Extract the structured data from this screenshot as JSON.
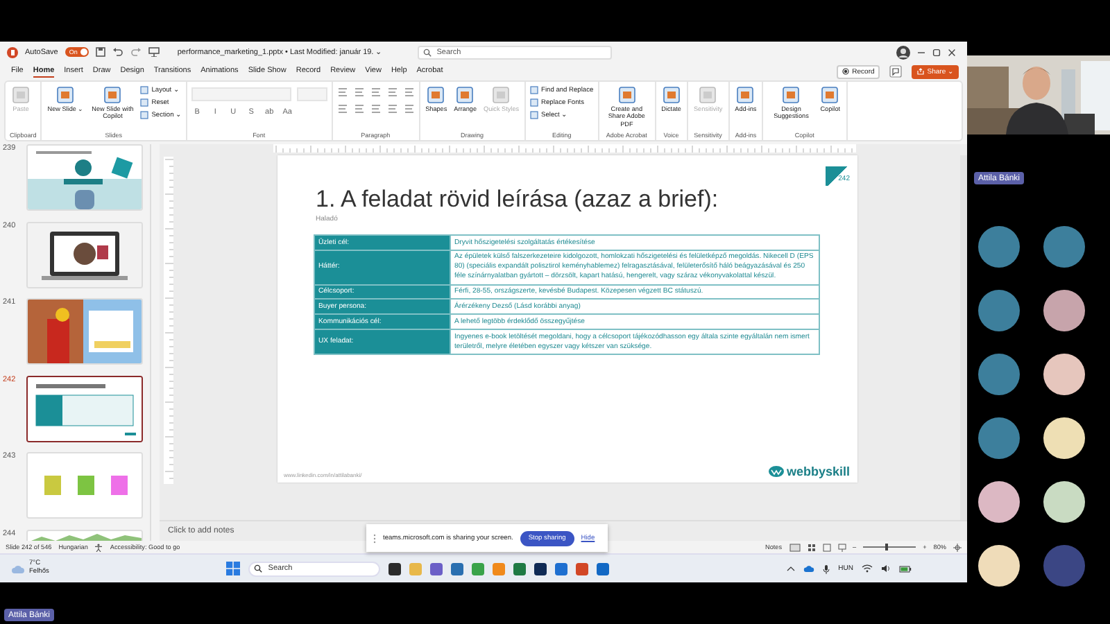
{
  "title_bar": {
    "autosave_label": "AutoSave",
    "autosave": {
      "on": true,
      "label": "On"
    },
    "file_title": "performance_marketing_1.pptx • Last Modified: január 19. ⌄",
    "search_placeholder": "Search"
  },
  "menu_tabs": [
    {
      "label": "File",
      "selected": false
    },
    {
      "label": "Home",
      "selected": true
    },
    {
      "label": "Insert",
      "selected": false
    },
    {
      "label": "Draw",
      "selected": false
    },
    {
      "label": "Design",
      "selected": false
    },
    {
      "label": "Transitions",
      "selected": false
    },
    {
      "label": "Animations",
      "selected": false
    },
    {
      "label": "Slide Show",
      "selected": false
    },
    {
      "label": "Record",
      "selected": false
    },
    {
      "label": "Review",
      "selected": false
    },
    {
      "label": "View",
      "selected": false
    },
    {
      "label": "Help",
      "selected": false
    },
    {
      "label": "Acrobat",
      "selected": false
    }
  ],
  "record_button": "Record",
  "share_button": "Share ⌄",
  "ribbon_groups": [
    {
      "kind": "buttons",
      "label": "Clipboard",
      "items": [
        {
          "label": "Paste",
          "kind": "large",
          "disabled": true
        }
      ]
    },
    {
      "kind": "buttons",
      "label": "Slides",
      "items": [
        {
          "label": "New Slide ⌄",
          "kind": "large",
          "disabled": false
        },
        {
          "label": "New Slide with Copilot",
          "kind": "large",
          "disabled": false
        },
        {
          "label": "Layout ⌄",
          "kind": "small",
          "disabled": false
        },
        {
          "label": "Reset",
          "kind": "small",
          "disabled": false
        },
        {
          "label": "Section ⌄",
          "kind": "small",
          "disabled": false
        }
      ]
    },
    {
      "kind": "font",
      "label": "Font",
      "items": [
        {
          "label": "B"
        },
        {
          "label": "I"
        },
        {
          "label": "U"
        },
        {
          "label": "S"
        },
        {
          "label": "ab"
        },
        {
          "label": "Aa"
        }
      ]
    },
    {
      "kind": "paragraph",
      "label": "Paragraph"
    },
    {
      "kind": "buttons",
      "label": "Drawing",
      "items": [
        {
          "label": "Shapes",
          "kind": "large",
          "disabled": false
        },
        {
          "label": "Arrange",
          "kind": "large",
          "disabled": false
        },
        {
          "label": "Quick Styles",
          "kind": "large",
          "disabled": true
        }
      ]
    },
    {
      "kind": "buttons",
      "label": "Editing",
      "items": [
        {
          "label": "Find and Replace",
          "kind": "small",
          "disabled": false
        },
        {
          "label": "Replace Fonts",
          "kind": "small",
          "disabled": false
        },
        {
          "label": "Select ⌄",
          "kind": "small",
          "disabled": false
        }
      ]
    },
    {
      "kind": "buttons",
      "label": "Adobe Acrobat",
      "items": [
        {
          "label": "Create and Share Adobe PDF",
          "kind": "large",
          "disabled": false
        }
      ]
    },
    {
      "kind": "buttons",
      "label": "Voice",
      "items": [
        {
          "label": "Dictate",
          "kind": "large",
          "disabled": false
        }
      ]
    },
    {
      "kind": "buttons",
      "label": "Sensitivity",
      "items": [
        {
          "label": "Sensitivity",
          "kind": "large",
          "disabled": true
        }
      ]
    },
    {
      "kind": "buttons",
      "label": "Add-ins",
      "items": [
        {
          "label": "Add-ins",
          "kind": "large",
          "disabled": false
        }
      ]
    },
    {
      "kind": "buttons",
      "label": "Copilot",
      "items": [
        {
          "label": "Design Suggestions",
          "kind": "large",
          "disabled": false
        },
        {
          "label": "Copilot",
          "kind": "large",
          "disabled": false
        }
      ]
    }
  ],
  "thumbnails": [
    {
      "number": "239",
      "selected": false,
      "kind": "brand"
    },
    {
      "number": "240",
      "selected": false,
      "kind": "laptop"
    },
    {
      "number": "241",
      "selected": false,
      "kind": "worker"
    },
    {
      "number": "242",
      "selected": true,
      "kind": "table"
    },
    {
      "number": "243",
      "selected": false,
      "kind": "notes"
    },
    {
      "number": "244",
      "selected": false,
      "kind": "chart"
    }
  ],
  "slide": {
    "title": "1. A feladat rövid leírása (azaz a brief):",
    "subtitle": "Haladó",
    "corner_number": "242",
    "rows": [
      {
        "label": "Üzleti cél:",
        "value": "Dryvit hőszigetelési szolgáltatás értékesítése"
      },
      {
        "label": "Háttér:",
        "value": "Az épületek külső falszerkezeteire kidolgozott, homlokzati hőszigetelési és felületképző megoldás. Nikecell D (EPS 80) (speciális expandált polisztirol keményhablemez) felragasztásával, felületerősítő háló beágyazásával és 250 féle színárnyalatban gyártott – dörzsölt, kapart hatású, hengerelt, vagy száraz vékonyvakolattal készül."
      },
      {
        "label": "Célcsoport:",
        "value": "Férfi, 28-55, országszerte, kevésbé Budapest. Közepesen végzett BC státuszú."
      },
      {
        "label": "Buyer persona:",
        "value": "Árérzékeny Dezső (Lásd korábbi anyag)"
      },
      {
        "label": "Kommunikációs cél:",
        "value": "A lehető legtöbb érdeklődő összegyűjtése"
      },
      {
        "label": "UX feladat:",
        "value": "Ingyenes e-book letöltését megoldani, hogy a célcsoport tájékozódhasson egy általa szinte egyáltalán nem ismert területről, melyre életében egyszer vagy kétszer van szüksége."
      }
    ],
    "footer_link": "www.linkedin.com/in/attilabanki/",
    "logo": "webbyskill"
  },
  "notes_placeholder": "Click to add notes",
  "share_banner": {
    "message": "teams.microsoft.com is sharing your screen.",
    "stop": "Stop sharing",
    "hide": "Hide"
  },
  "status_bar": {
    "slide": "Slide 242 of 546",
    "language": "Hungarian",
    "accessibility": "Accessibility: Good to go",
    "notes": "Notes",
    "zoom_minus": "–",
    "zoom_plus": "+",
    "zoom": {
      "level": 0.45
    },
    "zoom_reading": "80%"
  },
  "taskbar": {
    "temperature": "7°C",
    "weather": "Felhős",
    "search_placeholder": "Search",
    "language": "HUN",
    "apps": [
      {
        "color": "#2b2b2b"
      },
      {
        "color": "#e8b84a"
      },
      {
        "color": "#6b5fc7"
      },
      {
        "color": "#2a6fb0"
      },
      {
        "color": "#3aa34a"
      },
      {
        "color": "#f08a1c"
      },
      {
        "color": "#1f7a44"
      },
      {
        "color": "#0f2a55"
      },
      {
        "color": "#1e6fd0"
      },
      {
        "color": "#d24726"
      },
      {
        "color": "#1268c4"
      }
    ]
  },
  "participants": {
    "presenter_badge": "Attila Bánki",
    "avatars": [
      {
        "color": "#3d7f9c"
      },
      {
        "color": "#3d7f9c"
      },
      {
        "color": "#3d7f9c"
      },
      {
        "color": "#c7a4ab"
      },
      {
        "color": "#3d7f9c"
      },
      {
        "color": "#e6c6bd"
      },
      {
        "color": "#3d7f9c"
      },
      {
        "color": "#eedfb4"
      },
      {
        "color": "#dcb8c3"
      },
      {
        "color": "#c9dbc2"
      },
      {
        "color": "#efdcb9"
      },
      {
        "color": "#3b4684"
      }
    ]
  },
  "footer_badge": "Attila Bánki"
}
